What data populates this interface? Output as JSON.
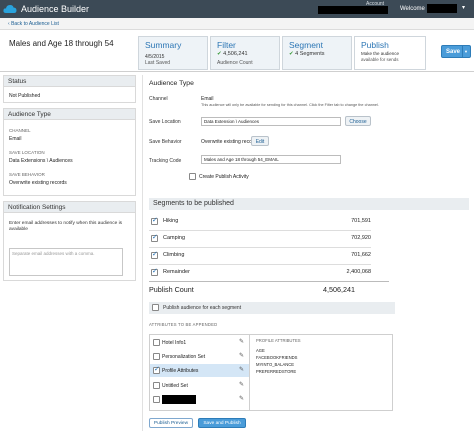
{
  "app": {
    "title": "Audience Builder",
    "account_label": "Account",
    "welcome_label": "Welcome"
  },
  "breadcrumb": {
    "back_label": "Back to Audience List"
  },
  "header": {
    "audience_name": "Males and Age 18 through 54",
    "save_label": "Save",
    "tabs": [
      {
        "label": "Summary",
        "line1": "4/5/2015",
        "line2": "Last Saved"
      },
      {
        "label": "Filter",
        "line1": "4,506,241",
        "line2": "Audience Count"
      },
      {
        "label": "Segment",
        "line1": "4 Segments",
        "line2": ""
      },
      {
        "label": "Publish",
        "line1": "Make the audience",
        "line2": "available for sends"
      }
    ]
  },
  "sidebar": {
    "status": {
      "title": "Status",
      "value": "Not Published"
    },
    "audience_type": {
      "title": "Audience Type",
      "channel_label": "CHANNEL",
      "channel_value": "Email",
      "save_location_label": "SAVE LOCATION",
      "save_location_value": "Data Extensions \\ Audiences",
      "save_behavior_label": "SAVE BEHAVIOR",
      "save_behavior_value": "Overwrite existing records"
    },
    "notification": {
      "title": "Notification Settings",
      "description": "Enter email addresses to notify when this audience is available",
      "placeholder": "Separate email addresses with a comma."
    }
  },
  "main": {
    "audience_type_title": "Audience Type",
    "channel_label": "Channel",
    "channel_value": "Email",
    "channel_note": "This audience will only be available for sending for this channel. Click the Filter tab to change the channel.",
    "save_location_label": "Save Location",
    "save_location_value": "Data Extension \\ Audiences",
    "choose_label": "Choose",
    "save_behavior_label": "Save Behavior",
    "save_behavior_value": "Overwrite existing records",
    "edit_label": "Edit",
    "tracking_code_label": "Tracking Code",
    "tracking_code_value": "Males and Age 18 through 54_EMAIL",
    "create_activity_label": "Create Publish Activity",
    "segments_title": "Segments to be published",
    "segments": [
      {
        "name": "Hiking",
        "count": "701,591",
        "checked": true
      },
      {
        "name": "Camping",
        "count": "702,920",
        "checked": true
      },
      {
        "name": "Climbing",
        "count": "701,662",
        "checked": true
      },
      {
        "name": "Remainder",
        "count": "2,400,068",
        "checked": true
      }
    ],
    "publish_count_label": "Publish Count",
    "publish_count_value": "4,506,241",
    "publish_each_label": "Publish audience for each segment",
    "attributes_title": "ATTRIBUTES TO BE APPENDED",
    "attribute_sets": [
      {
        "name": "Hotel Info1",
        "checked": false,
        "selected": false
      },
      {
        "name": "Personalization Set",
        "checked": false,
        "selected": false
      },
      {
        "name": "Profile Attributes",
        "checked": true,
        "selected": true
      },
      {
        "name": "Untitled Set",
        "checked": false,
        "selected": false
      },
      {
        "name": "",
        "checked": false,
        "selected": false
      }
    ],
    "profile_attributes_title": "PROFILE ATTRIBUTES",
    "profile_attributes": [
      "AGE",
      "FACEBOOKFRIENDS",
      "MYINTO_BALANCE",
      "PREFERREDSTORE"
    ],
    "publish_preview_label": "Publish Preview",
    "save_publish_label": "Save and Publish"
  },
  "colors": {
    "topbar": "#3c4a56",
    "accent": "#4a9cd9",
    "link": "#1a5d92",
    "selected_row": "#d4e6f6"
  }
}
